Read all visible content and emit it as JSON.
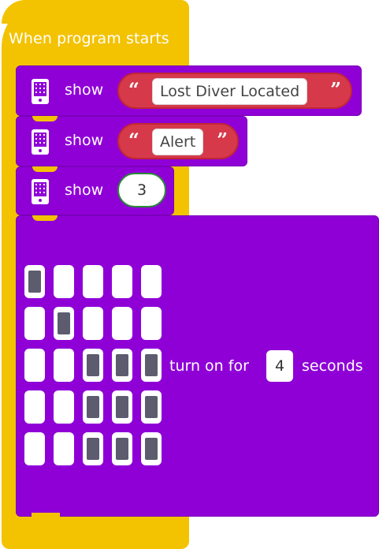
{
  "hat": {
    "label": "When program starts"
  },
  "blocks": [
    {
      "kind": "show-text",
      "label": "show",
      "value": "Lost Diver Located"
    },
    {
      "kind": "show-text",
      "label": "show",
      "value": "Alert"
    },
    {
      "kind": "show-number",
      "label": "show",
      "value": "3"
    }
  ],
  "led_block": {
    "grid": [
      [
        1,
        0,
        0,
        0,
        0
      ],
      [
        0,
        1,
        0,
        0,
        0
      ],
      [
        0,
        0,
        1,
        1,
        1
      ],
      [
        0,
        0,
        1,
        1,
        1
      ],
      [
        0,
        0,
        1,
        1,
        1
      ]
    ],
    "prefix": "turn on for",
    "seconds": "4",
    "suffix": "seconds"
  },
  "colors": {
    "hat": "#f3c200",
    "block": "#8f00d7",
    "string_pill": "#d63a4a",
    "led_on": "#5c5c6e"
  },
  "icons": {
    "block_icon": "microbit-device-icon"
  }
}
